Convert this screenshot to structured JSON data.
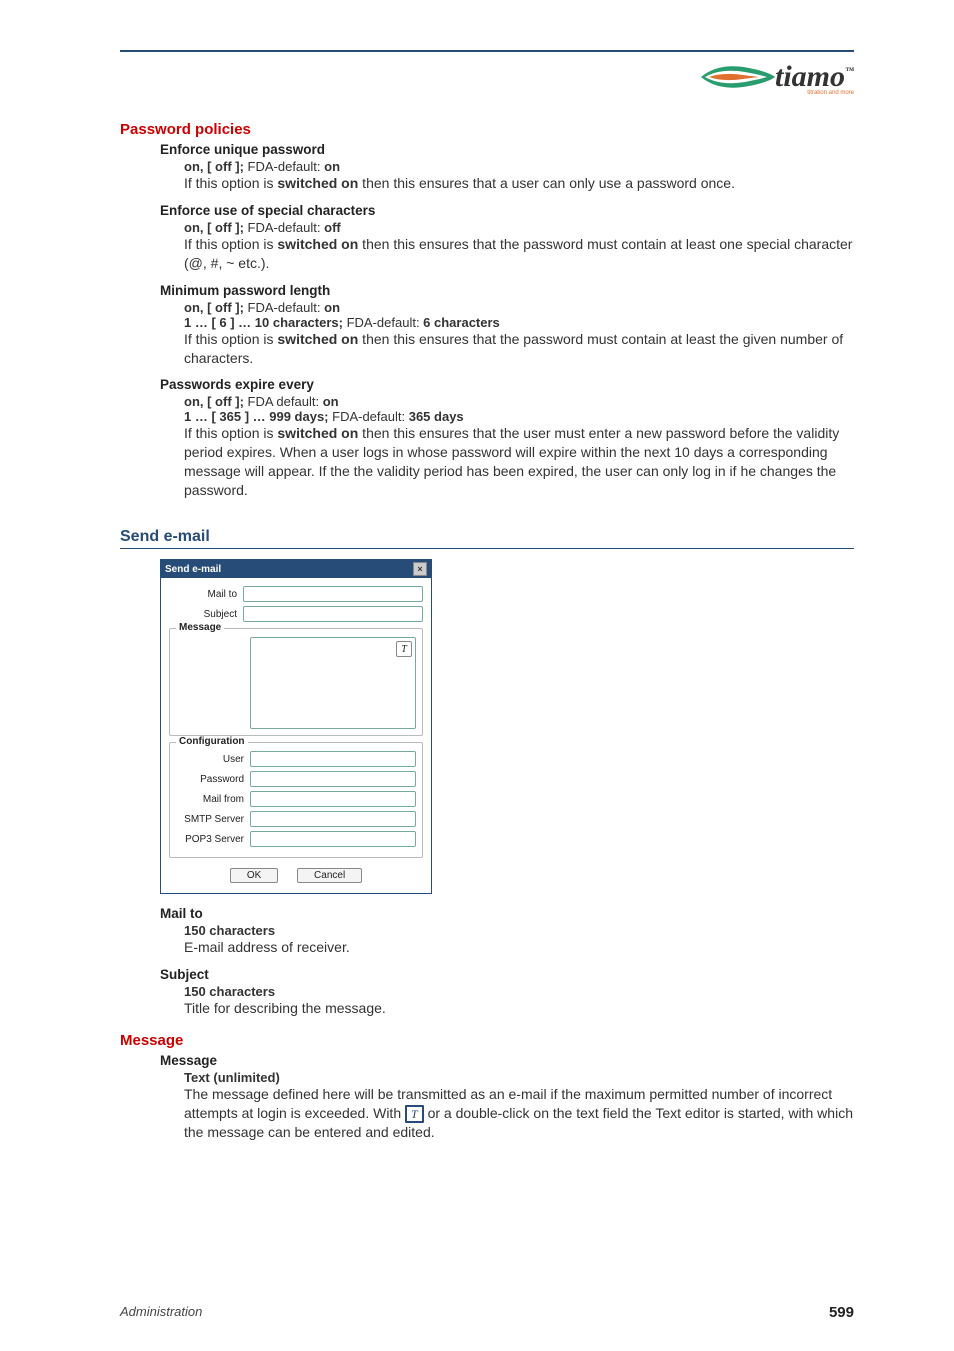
{
  "logo": {
    "text": "tiamo",
    "tm": "™",
    "tagline": "titration and more"
  },
  "headings": {
    "password_policies": "Password policies",
    "send_email": "Send e-mail",
    "message": "Message"
  },
  "params": {
    "unique_pw": {
      "title": "Enforce unique password",
      "default_prefix": "on, [ off ];",
      "default_label": " FDA-default: ",
      "default_value": "on",
      "desc_pre": "If this option is ",
      "desc_bold": "switched on",
      "desc_post": " then this ensures that a user can only use a password once."
    },
    "special_chars": {
      "title": "Enforce use of special characters",
      "default_prefix": "on, [ off ];",
      "default_label": " FDA-default: ",
      "default_value": "off",
      "desc_pre": "If this option is ",
      "desc_bold": "switched on",
      "desc_post": " then this ensures that the password must contain at least one special character (@, #, ~ etc.)."
    },
    "min_length": {
      "title": "Minimum password length",
      "default_prefix": "on, [ off ];",
      "default_label": " FDA-default: ",
      "default_value": "on",
      "range_prefix": "1 … [ 6 ] … 10 characters;",
      "range_label": " FDA-default: ",
      "range_value": "6 characters",
      "desc_pre": "If this option is ",
      "desc_bold": "switched on",
      "desc_post": " then this ensures that the password must contain at least the given number of characters."
    },
    "expire": {
      "title": "Passwords expire every",
      "default_prefix": "on, [ off ];",
      "default_label": " FDA default: ",
      "default_value": "on",
      "range_prefix": "1 … [ 365 ] … 999 days;",
      "range_label": " FDA-default: ",
      "range_value": "365 days",
      "desc_pre": "If this option is ",
      "desc_bold": "switched on",
      "desc_post": " then this ensures that the user must enter a new password before the validity period expires. When a user logs in whose password will expire within the next 10 days a corresponding message will appear. If the the validity period has been expired, the user can only log in if he changes the password."
    },
    "mail_to": {
      "title": "Mail to",
      "limit": "150 characters",
      "desc": "E-mail address of receiver."
    },
    "subject": {
      "title": "Subject",
      "limit": "150 characters",
      "desc": "Title for describing the message."
    },
    "msg": {
      "title": "Message",
      "limit": "Text (unlimited)",
      "desc1": "The message defined here will be transmitted as an e-mail if the maximum permitted number of incorrect attempts at login is exceeded. With ",
      "t_icon": "T",
      "desc2": " or a double-click on the text field the Text editor is started, with which the message can be entered and edited."
    }
  },
  "dialog": {
    "title": "Send e-mail",
    "close": "×",
    "mail_to": "Mail to",
    "subject": "Subject",
    "message_legend": "Message",
    "t_btn": "T",
    "config_legend": "Configuration",
    "user": "User",
    "password": "Password",
    "mail_from": "Mail from",
    "smtp": "SMTP Server",
    "pop3": "POP3 Server",
    "ok": "OK",
    "cancel": "Cancel"
  },
  "footer": {
    "left": "Administration",
    "right": "599"
  }
}
